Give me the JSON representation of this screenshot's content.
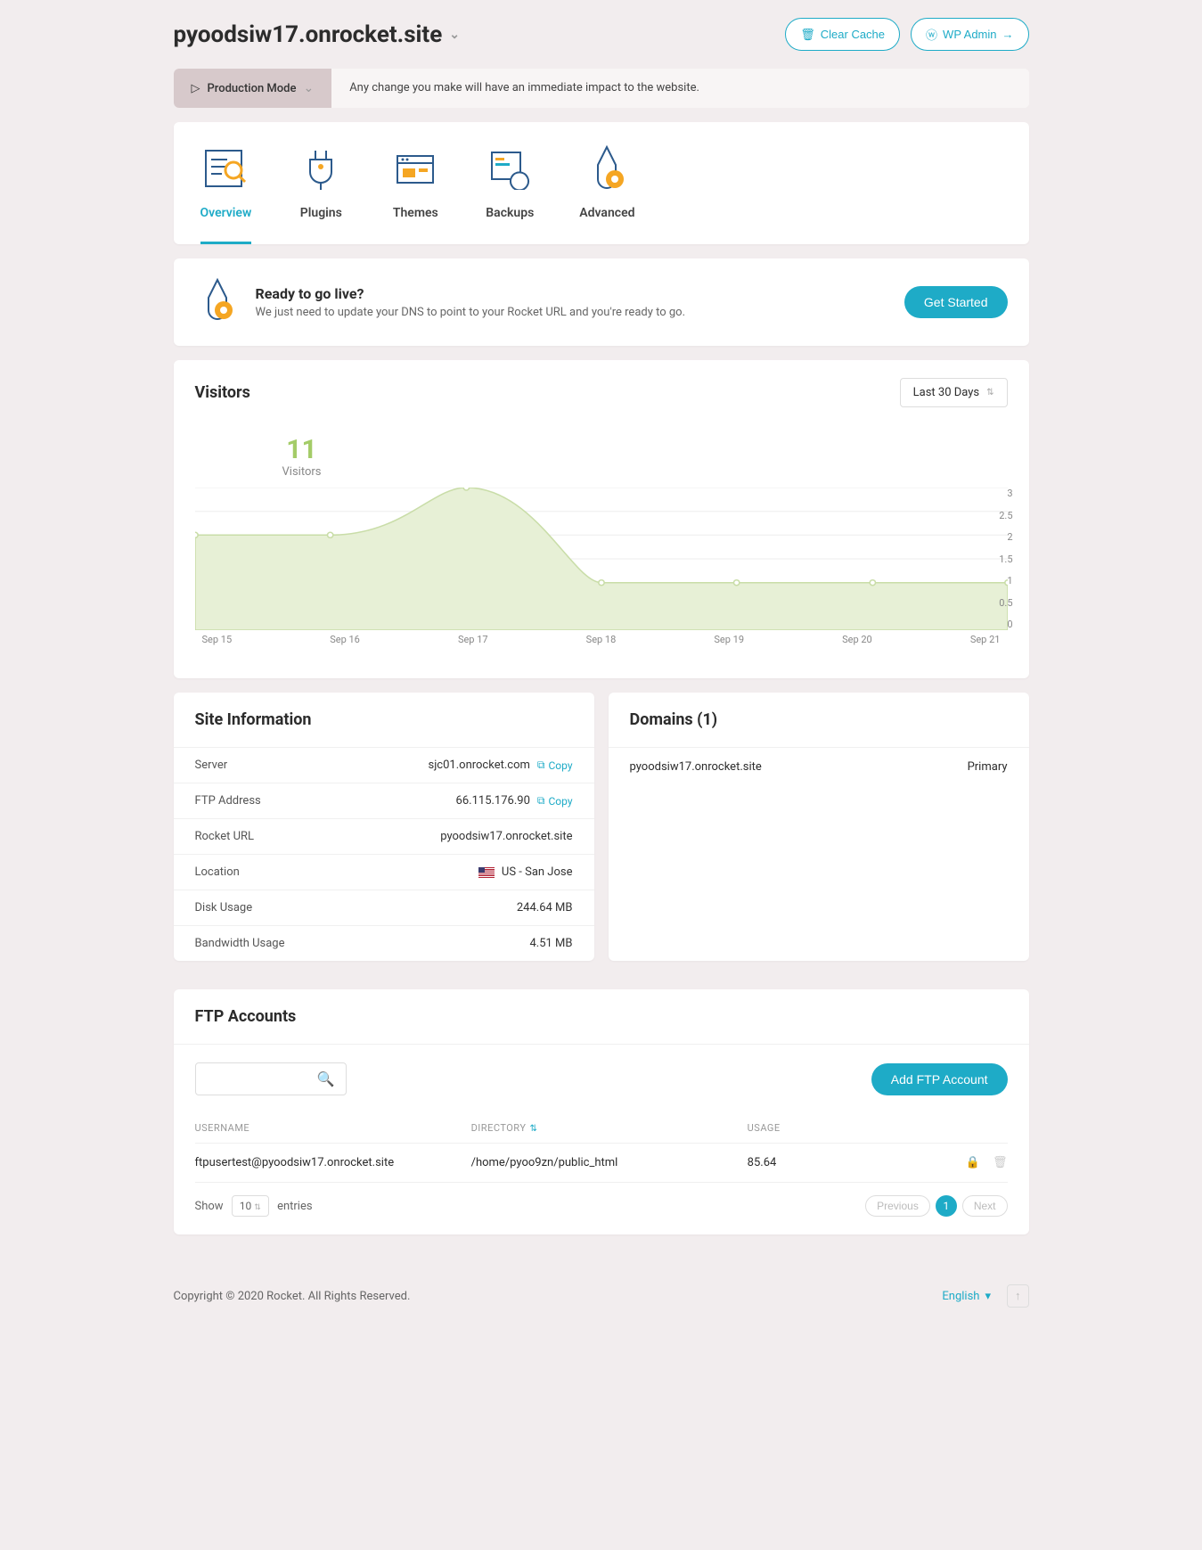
{
  "site_name": "pyoodsiw17.onrocket.site",
  "header_buttons": {
    "clear_cache": "Clear Cache",
    "wp_admin": "WP Admin"
  },
  "mode": {
    "label": "Production Mode",
    "message": "Any change you make will have an immediate impact to the website."
  },
  "tabs": {
    "overview": "Overview",
    "plugins": "Plugins",
    "themes": "Themes",
    "backups": "Backups",
    "advanced": "Advanced"
  },
  "golive": {
    "title": "Ready to go live?",
    "desc": "We just need to update your DNS to point to your Rocket URL and you're ready to go.",
    "cta": "Get Started"
  },
  "visitors": {
    "title": "Visitors",
    "range": "Last 30 Days",
    "count": "11",
    "count_label": "Visitors"
  },
  "chart_data": {
    "type": "area",
    "categories": [
      "Sep 15",
      "Sep 16",
      "Sep 17",
      "Sep 18",
      "Sep 19",
      "Sep 20",
      "Sep 21"
    ],
    "values": [
      2.0,
      2.0,
      3.0,
      1.0,
      1.0,
      1.0,
      1.0
    ],
    "title": "Visitors",
    "xlabel": "",
    "ylabel": "",
    "ylim": [
      0,
      3.0
    ],
    "yticks": [
      0,
      0.5,
      1.0,
      1.5,
      2.0,
      2.5,
      3.0
    ]
  },
  "siteinfo": {
    "title": "Site Information",
    "rows": {
      "server_label": "Server",
      "server_val": "sjc01.onrocket.com",
      "ftp_label": "FTP Address",
      "ftp_val": "66.115.176.90",
      "url_label": "Rocket URL",
      "url_val": "pyoodsiw17.onrocket.site",
      "loc_label": "Location",
      "loc_val": "US - San Jose",
      "disk_label": "Disk Usage",
      "disk_val": "244.64 MB",
      "bw_label": "Bandwidth Usage",
      "bw_val": "4.51 MB"
    },
    "copy": "Copy"
  },
  "domains": {
    "title": "Domains (1)",
    "name": "pyoodsiw17.onrocket.site",
    "status": "Primary"
  },
  "ftp": {
    "title": "FTP Accounts",
    "add_btn": "Add FTP Account",
    "cols": {
      "user": "USERNAME",
      "dir": "DIRECTORY",
      "usage": "USAGE"
    },
    "row": {
      "user": "ftpusertest@pyoodsiw17.onrocket.site",
      "dir": "/home/pyoo9zn/public_html",
      "usage": "85.64"
    },
    "show": "Show",
    "entries": "entries",
    "entries_val": "10",
    "prev": "Previous",
    "page": "1",
    "next": "Next"
  },
  "footer": {
    "copyright": "Copyright © 2020 Rocket. All Rights Reserved.",
    "lang": "English"
  }
}
